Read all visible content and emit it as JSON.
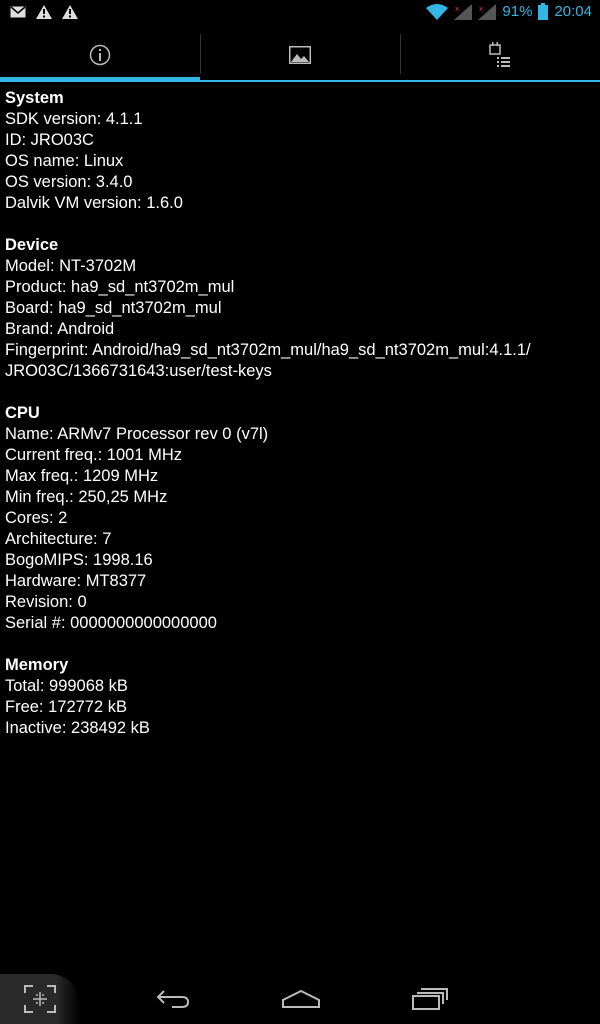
{
  "status_bar": {
    "battery_percent": "91%",
    "time": "20:04",
    "icons": [
      "mail-icon",
      "warning-icon",
      "warning-icon",
      "wifi-icon",
      "signal-icon",
      "signal-icon",
      "battery-icon"
    ]
  },
  "tabs": [
    {
      "icon": "info-icon",
      "active": true
    },
    {
      "icon": "image-icon",
      "active": false
    },
    {
      "icon": "task-list-icon",
      "active": false
    }
  ],
  "sections": [
    {
      "title": "System",
      "lines": [
        "SDK version: 4.1.1",
        "ID: JRO03C",
        "OS name: Linux",
        "OS version: 3.4.0",
        "Dalvik VM version: 1.6.0"
      ]
    },
    {
      "title": "Device",
      "lines": [
        "Model: NT-3702M",
        "Product: ha9_sd_nt3702m_mul",
        "Board: ha9_sd_nt3702m_mul",
        "Brand: Android",
        "Fingerprint: Android/ha9_sd_nt3702m_mul/ha9_sd_nt3702m_mul:4.1.1/",
        "JRO03C/1366731643:user/test-keys"
      ]
    },
    {
      "title": "CPU",
      "lines": [
        "Name: ARMv7 Processor rev 0 (v7l)",
        "Current freq.: 1001 MHz",
        "Max freq.: 1209 MHz",
        "Min freq.: 250,25 MHz",
        "Cores: 2",
        "Architecture: 7",
        "BogoMIPS: 1998.16",
        "Hardware: MT8377",
        "Revision: 0",
        "Serial #: 0000000000000000"
      ]
    },
    {
      "title": "Memory",
      "lines": [
        "Total: 999068 kB",
        "Free: 172772 kB",
        "Inactive: 238492 kB"
      ]
    }
  ],
  "colors": {
    "accent": "#33b5e5",
    "background": "#000000",
    "text": "#ffffff"
  }
}
